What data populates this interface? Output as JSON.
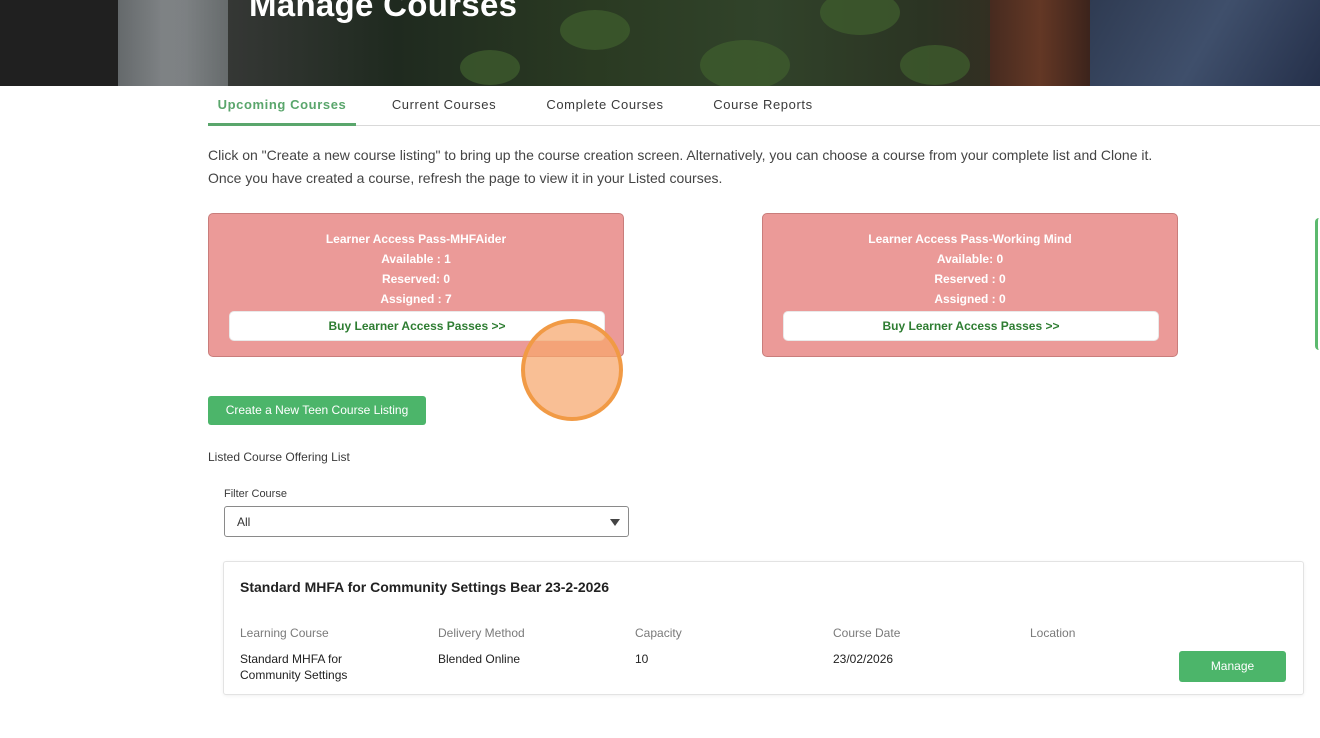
{
  "hero": {
    "title": "Manage Courses"
  },
  "tabs": [
    {
      "label": "Upcoming Courses",
      "active": true
    },
    {
      "label": "Current Courses",
      "active": false
    },
    {
      "label": "Complete Courses",
      "active": false
    },
    {
      "label": "Course Reports",
      "active": false
    }
  ],
  "intro": {
    "line1": "Click on \"Create a new course listing\" to bring up the course creation screen. Alternatively, you can choose a course from your complete list and Clone it.",
    "line2": "Once you have created a course, refresh the page to view it in your Listed courses."
  },
  "passes": [
    {
      "title": "Learner Access Pass-MHFAider",
      "available": "Available : 1",
      "reserved": "Reserved: 0",
      "assigned": "Assigned : 7",
      "buy_label": "Buy Learner Access Passes >>"
    },
    {
      "title": "Learner Access Pass-Working Mind",
      "available": "Available: 0",
      "reserved": "Reserved : 0",
      "assigned": "Assigned : 0",
      "buy_label": "Buy Learner Access Passes >>"
    }
  ],
  "create_button": "Create a New Teen Course Listing",
  "list_label": "Listed Course Offering List",
  "filter": {
    "label": "Filter Course",
    "value": "All"
  },
  "course": {
    "title": "Standard MHFA for Community Settings Bear 23-2-2026",
    "headers": {
      "learning_course": "Learning Course",
      "delivery_method": "Delivery Method",
      "capacity": "Capacity",
      "course_date": "Course Date",
      "location": "Location"
    },
    "values": {
      "learning_course": "Standard MHFA for Community Settings",
      "delivery_method": "Blended Online",
      "capacity": "10",
      "course_date": "23/02/2026",
      "location": ""
    },
    "manage_label": "Manage"
  },
  "colors": {
    "accent": "#5aa66c",
    "button": "#4cb56a",
    "card_bg": "#eb9a98",
    "buy_text": "#2e7d32",
    "cursor": "#f19a45"
  }
}
